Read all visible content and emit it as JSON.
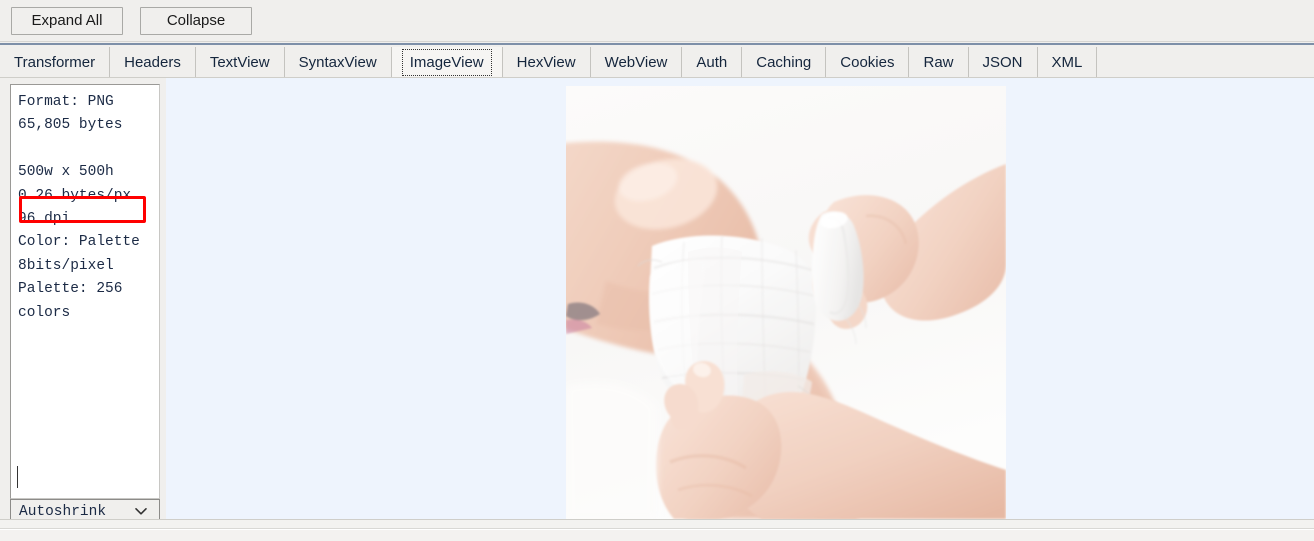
{
  "toolbar": {
    "expand_all_label": "Expand All",
    "collapse_label": "Collapse"
  },
  "tabs": [
    {
      "label": "Transformer",
      "selected": false
    },
    {
      "label": "Headers",
      "selected": false
    },
    {
      "label": "TextView",
      "selected": false
    },
    {
      "label": "SyntaxView",
      "selected": false
    },
    {
      "label": "ImageView",
      "selected": true
    },
    {
      "label": "HexView",
      "selected": false
    },
    {
      "label": "WebView",
      "selected": false
    },
    {
      "label": "Auth",
      "selected": false
    },
    {
      "label": "Caching",
      "selected": false
    },
    {
      "label": "Cookies",
      "selected": false
    },
    {
      "label": "Raw",
      "selected": false
    },
    {
      "label": "JSON",
      "selected": false
    },
    {
      "label": "XML",
      "selected": false
    }
  ],
  "info_panel": {
    "text": "Format: PNG\n65,805 bytes\n\n500w x 500h\n0.26 bytes/px\n96 dpi\nColor: Palette\n8bits/pixel\nPalette: 256\ncolors",
    "lines": [
      "Format: PNG",
      "65,805 bytes",
      "",
      "500w x 500h",
      "0.26 bytes/px",
      "96 dpi",
      "Color: Palette",
      "8bits/pixel",
      "Palette: 256",
      "colors"
    ],
    "format": "PNG",
    "file_size": "65,805 bytes",
    "dimensions": "500w x 500h",
    "bytes_per_pixel": "0.26 bytes/px",
    "dpi": "96 dpi",
    "color_mode": "Color: Palette",
    "bit_depth": "8bits/pixel",
    "palette": "Palette: 256",
    "palette_cont": "colors"
  },
  "annotation": {
    "highlight_color": "#ff0000",
    "highlight_target": "65,805 bytes"
  },
  "zoom_select": {
    "value": "Autoshrink",
    "icon": "chevron-down-icon"
  },
  "viewer": {
    "background_color": "#eef4fd",
    "image_alt": "Hands applying a white gauze bandage to a knee"
  }
}
